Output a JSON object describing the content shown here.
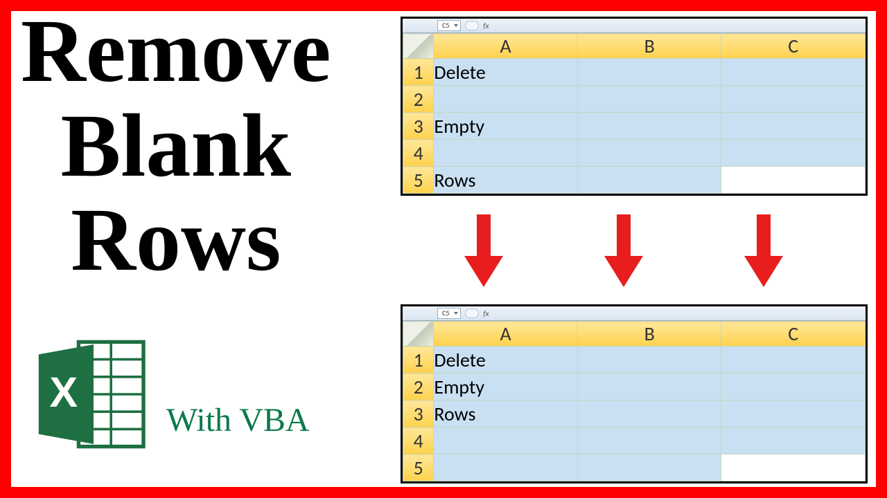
{
  "title": {
    "l1": "Remove",
    "l2": "Blank",
    "l3": "Rows"
  },
  "subtitle": "With VBA",
  "namebox": "C5",
  "fx": "fx",
  "cols": [
    "A",
    "B",
    "C"
  ],
  "sheet_top": {
    "rows": [
      "1",
      "2",
      "3",
      "4",
      "5"
    ],
    "data": [
      [
        "Delete",
        "",
        ""
      ],
      [
        "",
        "",
        ""
      ],
      [
        "Empty",
        "",
        ""
      ],
      [
        "",
        "",
        ""
      ],
      [
        "Rows",
        "",
        ""
      ]
    ],
    "active": {
      "r": 4,
      "c": 2
    }
  },
  "sheet_bottom": {
    "rows": [
      "1",
      "2",
      "3",
      "4",
      "5"
    ],
    "data": [
      [
        "Delete",
        "",
        ""
      ],
      [
        "Empty",
        "",
        ""
      ],
      [
        "Rows",
        "",
        ""
      ],
      [
        "",
        "",
        ""
      ],
      [
        "",
        "",
        ""
      ]
    ],
    "active": {
      "r": 4,
      "c": 2
    }
  },
  "logo": {
    "color_dark": "#1e6f41",
    "color_light": "#2fa366"
  }
}
